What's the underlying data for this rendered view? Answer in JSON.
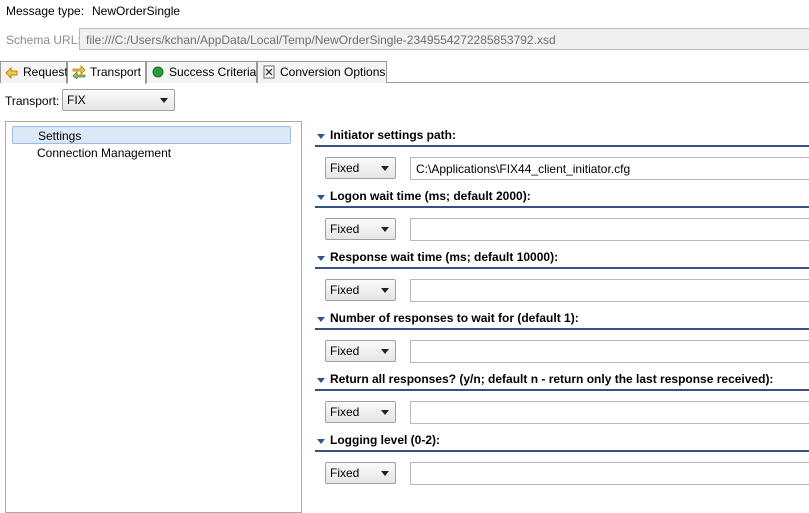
{
  "message_type": {
    "label": "Message type:",
    "value": "NewOrderSingle"
  },
  "schema_url": {
    "label": "Schema URL:",
    "value": "file:///C:/Users/kchan/AppData/Local/Temp/NewOrderSingle-2349554272285853792.xsd"
  },
  "tabs": [
    {
      "label": "Request",
      "icon": "request-icon"
    },
    {
      "label": "Transport",
      "icon": "transport-icon"
    },
    {
      "label": "Success Criteria",
      "icon": "success-criteria-icon"
    },
    {
      "label": "Conversion Options",
      "icon": "conversion-options-icon"
    }
  ],
  "transport": {
    "label": "Transport:",
    "selected": "FIX"
  },
  "tree": {
    "items": [
      {
        "label": "Settings"
      },
      {
        "label": "Connection Management"
      }
    ]
  },
  "settings": [
    {
      "title": "Initiator settings path:",
      "mode": "Fixed",
      "value": "C:\\Applications\\FIX44_client_initiator.cfg"
    },
    {
      "title": "Logon wait time (ms; default 2000):",
      "mode": "Fixed",
      "value": ""
    },
    {
      "title": "Response wait time (ms; default 10000):",
      "mode": "Fixed",
      "value": ""
    },
    {
      "title": "Number of responses to wait for (default 1):",
      "mode": "Fixed",
      "value": ""
    },
    {
      "title": "Return all responses? (y/n; default n - return only the last response received):",
      "mode": "Fixed",
      "value": ""
    },
    {
      "title": "Logging level (0-2):",
      "mode": "Fixed",
      "value": ""
    }
  ],
  "colors": {
    "section_rule": "#35518a",
    "selection": "#dbe8f8",
    "success_dot": "#2a9d3a"
  }
}
